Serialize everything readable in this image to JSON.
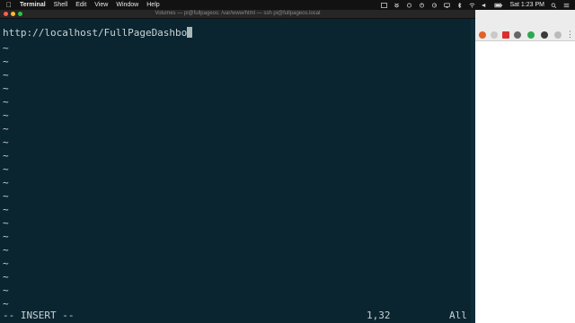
{
  "menubar": {
    "apple_icon": "apple-icon",
    "app_name": "Terminal",
    "items": [
      "Shell",
      "Edit",
      "View",
      "Window",
      "Help"
    ],
    "clock": "Sat 1:23 PM"
  },
  "window": {
    "title": "Volumes — pi@fullpageos: /var/www/html — ssh pi@fullpageos.local"
  },
  "terminal": {
    "line1": "http://localhost/FullPageDashbo",
    "tilde": "~",
    "mode": "-- INSERT --",
    "position": "1,32",
    "scroll": "All"
  },
  "colors": {
    "terminal_bg": "#0b2530",
    "text": "#c8d3d6",
    "close": "#ff5f57",
    "minimize": "#febc2e",
    "zoom": "#28c840"
  }
}
